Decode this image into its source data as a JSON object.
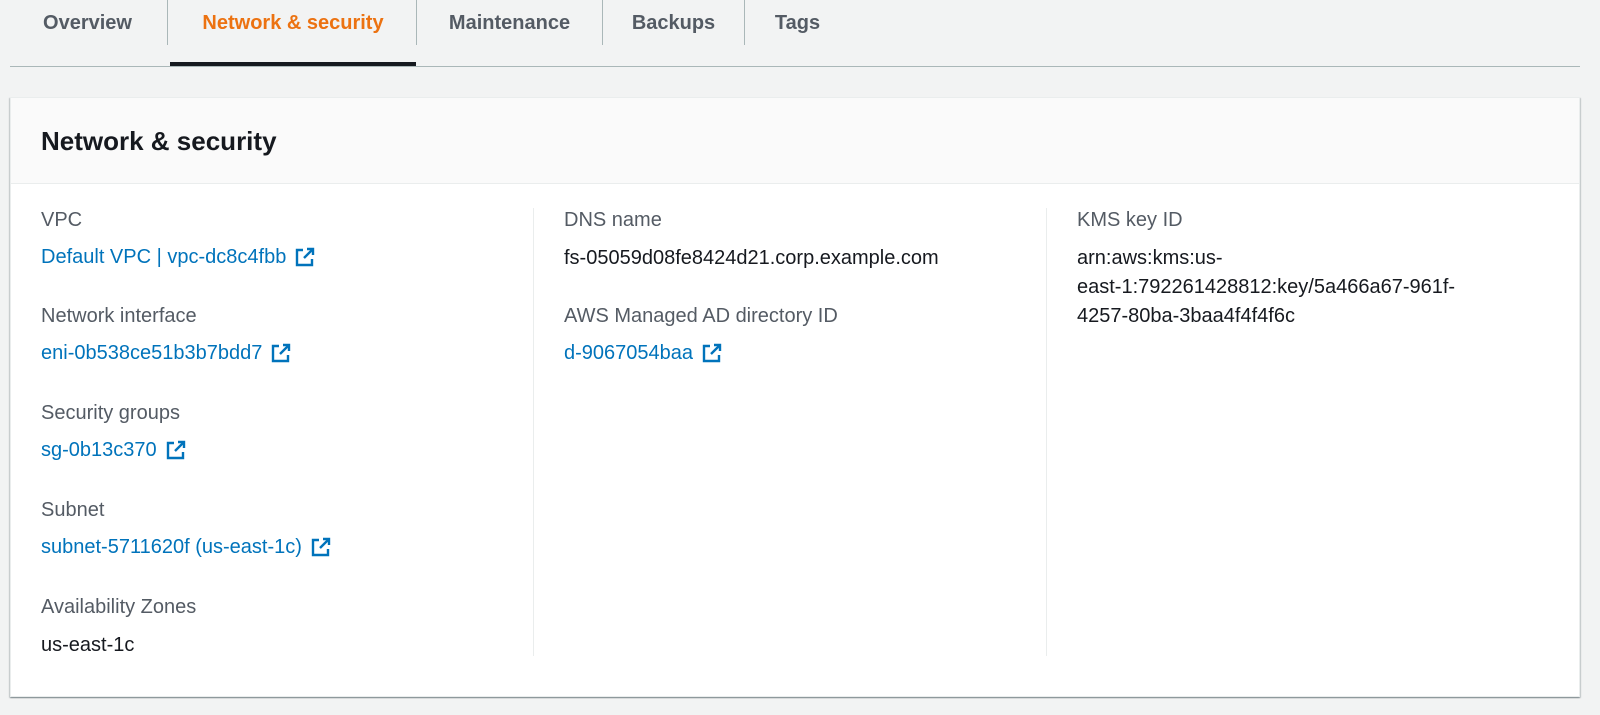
{
  "tabs": [
    {
      "label": "Overview",
      "active": false
    },
    {
      "label": "Network & security",
      "active": true
    },
    {
      "label": "Maintenance",
      "active": false
    },
    {
      "label": "Backups",
      "active": false
    },
    {
      "label": "Tags",
      "active": false
    }
  ],
  "panel": {
    "title": "Network & security"
  },
  "col1": {
    "vpc": {
      "label": "VPC",
      "value": "Default VPC | vpc-dc8c4fbb"
    },
    "network_interface": {
      "label": "Network interface",
      "value": "eni-0b538ce51b3b7bdd7"
    },
    "security_groups": {
      "label": "Security groups",
      "value": "sg-0b13c370"
    },
    "subnet": {
      "label": "Subnet",
      "value": "subnet-5711620f (us-east-1c)"
    },
    "availability_zones": {
      "label": "Availability Zones",
      "value": "us-east-1c"
    }
  },
  "col2": {
    "dns_name": {
      "label": "DNS name",
      "value": "fs-05059d08fe8424d21.corp.example.com"
    },
    "ad_directory": {
      "label": "AWS Managed AD directory ID",
      "value": "d-9067054baa"
    }
  },
  "col3": {
    "kms_key": {
      "label": "KMS key ID",
      "value_lines": [
        "arn:aws:kms:us-",
        "east-1:792261428812:key/5a466a67-961f-",
        "4257-80ba-3baa4f4f4f6c"
      ]
    }
  },
  "colors": {
    "active_tab": "#ec7211",
    "link": "#0073bb",
    "label": "#545b64",
    "text": "#16191f"
  },
  "icons": {
    "external_link": "external-link-icon"
  }
}
